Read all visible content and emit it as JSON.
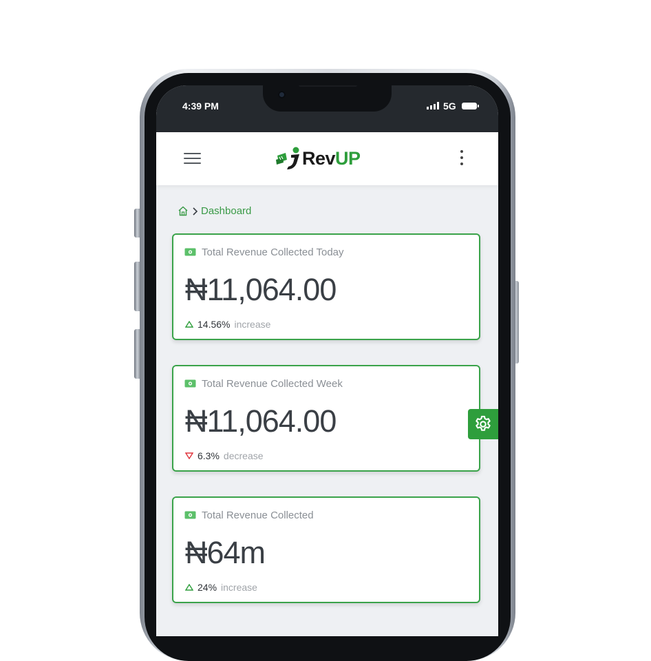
{
  "status_bar": {
    "time": "4:39 PM",
    "network": "5G"
  },
  "app_bar": {
    "logo": {
      "text_main": "Rev",
      "text_accent": "UP"
    },
    "menu_icon": "hamburger-icon",
    "more_icon": "kebab-icon"
  },
  "breadcrumb": {
    "home_icon": "home-icon",
    "separator_icon": "chevron-right-icon",
    "current": "Dashboard"
  },
  "cards": [
    {
      "title": "Total Revenue Collected Today",
      "amount": "₦11,064.00",
      "percent": "14.56%",
      "trend": "increase",
      "direction": "up"
    },
    {
      "title": "Total Revenue Collected Week",
      "amount": "₦11,064.00",
      "percent": "6.3%",
      "trend": "decrease",
      "direction": "down"
    },
    {
      "title": "Total Revenue Collected",
      "amount": "₦64m",
      "percent": "24%",
      "trend": "increase",
      "direction": "up"
    }
  ],
  "settings_fab": {
    "icon": "gear-icon"
  },
  "colors": {
    "brand_green": "#2e9e3c",
    "card_border": "#3aa34a",
    "increase": "#2e9e3c",
    "decrease": "#e0333c",
    "status_bar_bg": "#25292e",
    "page_bg": "#eef0f3"
  }
}
